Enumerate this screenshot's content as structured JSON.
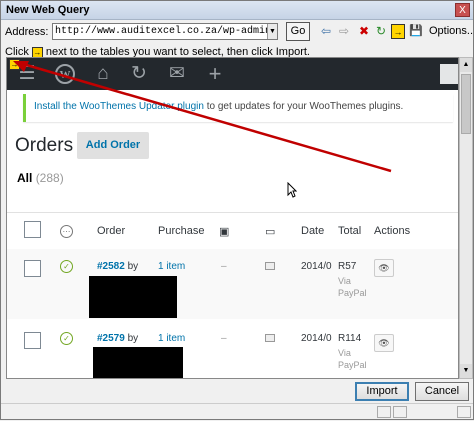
{
  "window": {
    "title": "New Web Query",
    "close_label": "X"
  },
  "address_bar": {
    "label": "Address:",
    "value": "http://www.auditexcel.co.za/wp-admin/edit.php?post_type=",
    "go_label": "Go",
    "options_label": "Options..."
  },
  "hint": {
    "before": "Click",
    "after": "next to the tables you want to select, then click Import."
  },
  "notice": {
    "link_text": "Install the WooThemes Updater plugin",
    "rest_text": " to get updates for your WooThemes plugins."
  },
  "page": {
    "title": "Orders",
    "add_order_label": "Add Order",
    "filter_all": "All",
    "filter_count": "(288)"
  },
  "table": {
    "headers": {
      "order": "Order",
      "purchase": "Purchase",
      "date": "Date",
      "total": "Total",
      "actions": "Actions"
    },
    "rows": [
      {
        "order": "#2582",
        "by": "by",
        "items": "1 item",
        "dash": "–",
        "date": "2014/0",
        "total": "R57",
        "via": "Via",
        "payment": "PayPal"
      },
      {
        "order": "#2579",
        "by": "by",
        "items": "1 item",
        "dash": "–",
        "date": "2014/0",
        "total": "R114",
        "via": "Via",
        "payment": "PayPal"
      }
    ]
  },
  "footer": {
    "import_label": "Import",
    "cancel_label": "Cancel"
  },
  "colors": {
    "wp_admin_bar": "#23282d",
    "link": "#0073aa",
    "annotation_arrow": "#c00000",
    "notice_border": "#7ad03a"
  }
}
